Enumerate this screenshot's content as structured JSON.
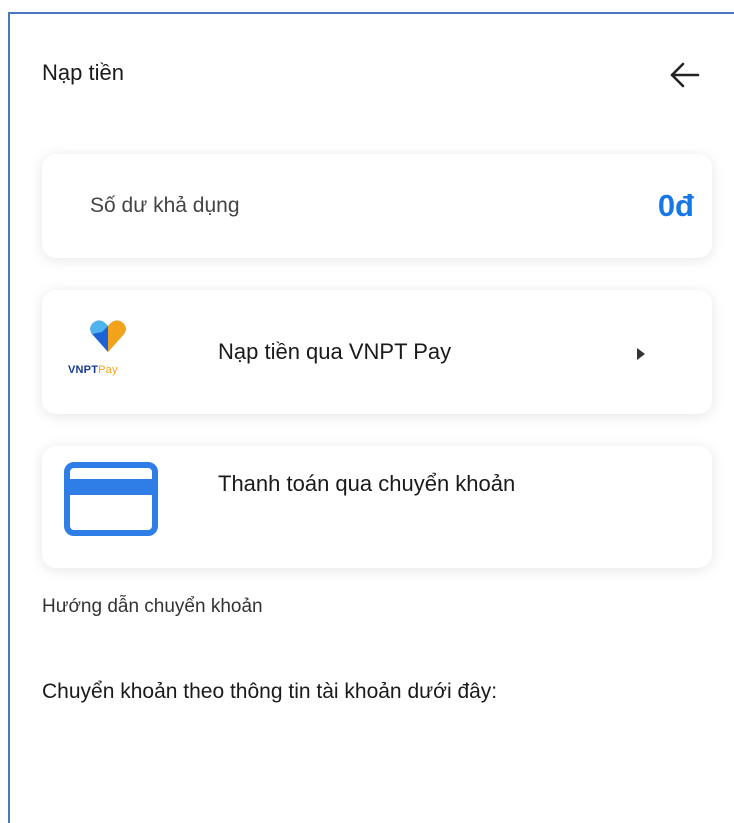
{
  "header": {
    "title": "Nạp tiền",
    "back_icon": "arrow-left-icon"
  },
  "balance": {
    "label": "Số dư khả dụng",
    "value": "0đ",
    "value_color": "#1677e6"
  },
  "payment_methods": [
    {
      "label": "Nạp tiền qua VNPT Pay",
      "icon": "vnpt-pay-logo",
      "logo_text_main": "VNPT",
      "logo_text_pay": "Pay",
      "trailing_icon": "caret-right-icon"
    },
    {
      "label": "Thanh toán qua chuyển khoản",
      "icon": "credit-card-icon"
    }
  ],
  "guide": {
    "title": "Hướng dẫn chuyển khoản",
    "description": "Chuyển khoản theo thông tin tài khoản dưới đây:"
  },
  "colors": {
    "frame": "#4a78bf",
    "accent": "#1677e6",
    "card_icon": "#2f7ee8",
    "vnpt_navy": "#153b8f",
    "vnpt_orange": "#f3a31a"
  }
}
